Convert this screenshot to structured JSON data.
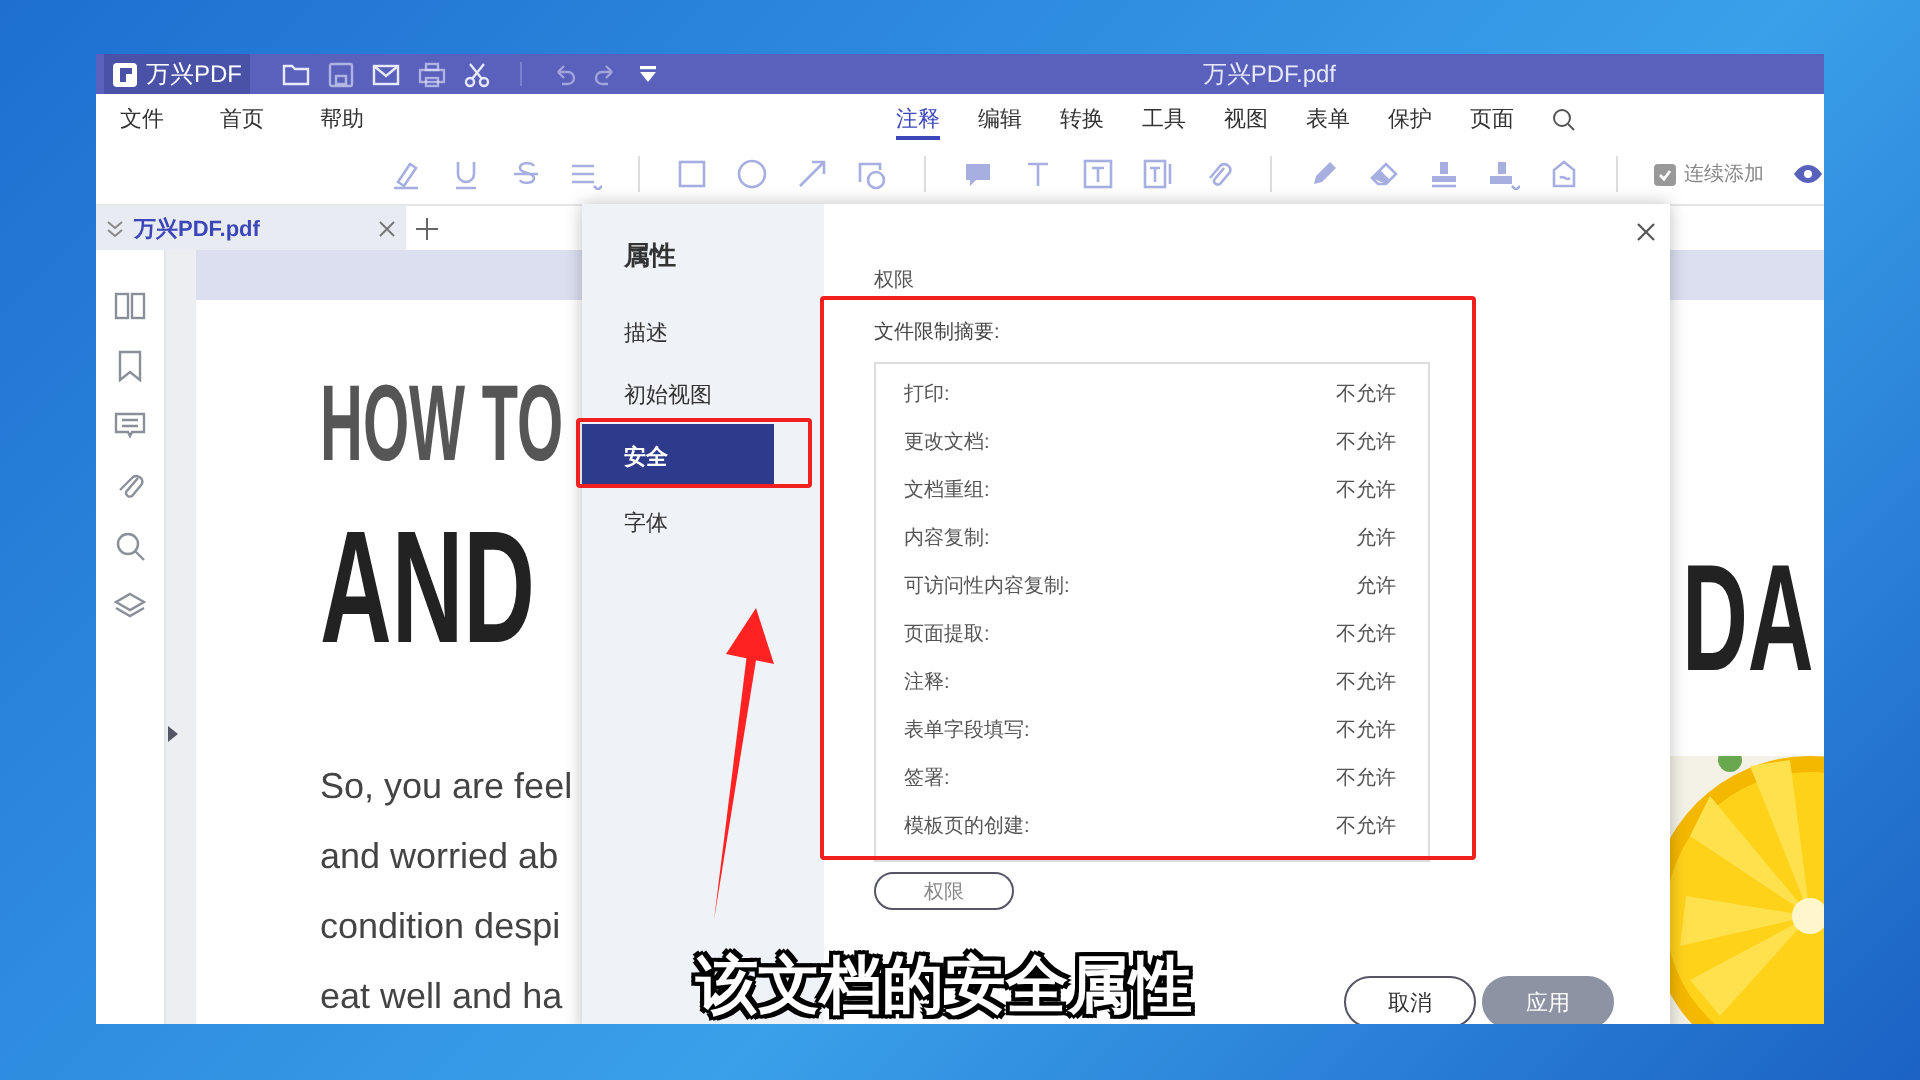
{
  "title_bar": {
    "app_name": "万兴PDF",
    "title": "万兴PDF.pdf"
  },
  "menu": [
    "文件",
    "首页",
    "帮助"
  ],
  "ribbon_tabs": [
    {
      "label": "注释",
      "selected": true
    },
    {
      "label": "编辑",
      "selected": false
    },
    {
      "label": "转换",
      "selected": false
    },
    {
      "label": "工具",
      "selected": false
    },
    {
      "label": "视图",
      "selected": false
    },
    {
      "label": "表单",
      "selected": false
    },
    {
      "label": "保护",
      "selected": false
    },
    {
      "label": "页面",
      "selected": false
    }
  ],
  "toolbar": {
    "continuous_add": {
      "label": "连续添加",
      "checked": true
    }
  },
  "document_tabs": [
    {
      "label": "万兴PDF.pdf",
      "selected": true
    }
  ],
  "document": {
    "heading_lines": [
      "HOW TO",
      "AND"
    ],
    "heading_right": "DA",
    "body_lines": [
      "So, you are feel",
      "and worried ab",
      "condition despi",
      "eat well and ha"
    ]
  },
  "dialog": {
    "title": "属性",
    "nav": [
      {
        "label": "描述",
        "selected": false
      },
      {
        "label": "初始视图",
        "selected": false
      },
      {
        "label": "安全",
        "selected": true
      },
      {
        "label": "字体",
        "selected": false
      }
    ],
    "section": "权限",
    "summary_label": "文件限制摘要:",
    "permissions": [
      {
        "label": "打印:",
        "value": "不允许"
      },
      {
        "label": "更改文档:",
        "value": "不允许"
      },
      {
        "label": "文档重组:",
        "value": "不允许"
      },
      {
        "label": "内容复制:",
        "value": "允许"
      },
      {
        "label": "可访问性内容复制:",
        "value": "允许"
      },
      {
        "label": "页面提取:",
        "value": "不允许"
      },
      {
        "label": "注释:",
        "value": "不允许"
      },
      {
        "label": "表单字段填写:",
        "value": "不允许"
      },
      {
        "label": "签署:",
        "value": "不允许"
      },
      {
        "label": "模板页的创建:",
        "value": "不允许"
      }
    ],
    "permissions_button": "权限",
    "buttons": [
      {
        "label": "取消",
        "disabled": false
      },
      {
        "label": "应用",
        "disabled": true
      }
    ]
  },
  "annotation": {
    "caption": "该文档的安全属性"
  }
}
